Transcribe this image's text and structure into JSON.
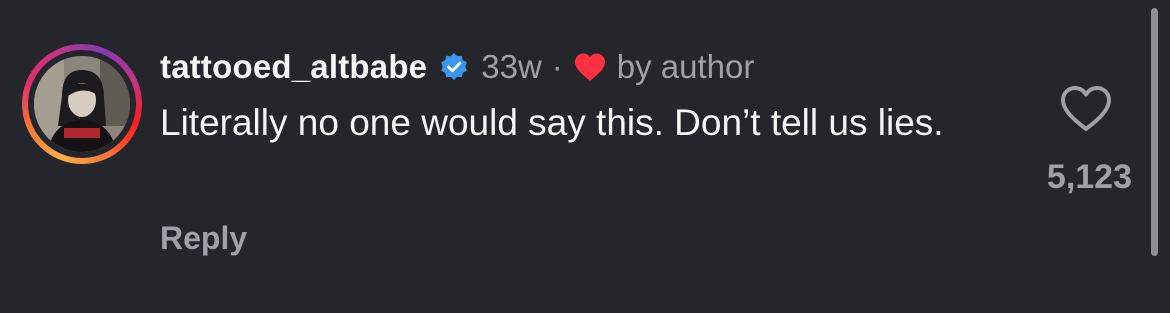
{
  "comment": {
    "username": "tattooed_altbabe",
    "verified": true,
    "age": "33w",
    "separator": "·",
    "liked_by": "by author",
    "text": "Literally no one would say this. Don’t tell us lies.",
    "reply_label": "Reply",
    "like_count": "5,123"
  },
  "icons": {
    "verified": "verified-badge-icon",
    "author_heart": "heart-filled-icon",
    "like": "heart-outline-icon"
  },
  "colors": {
    "background": "#25262b",
    "primary_text": "#f5f5f5",
    "secondary_text": "#9da1a8",
    "verified_blue": "#3897f0",
    "author_heart_red": "#ff3040"
  }
}
